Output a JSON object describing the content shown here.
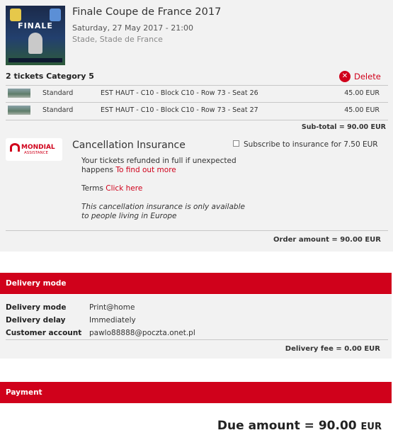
{
  "event": {
    "title": "Finale Coupe de France 2017",
    "date": "Saturday, 27 May 2017 - 21:00",
    "venue": "Stade, Stade de France",
    "thumbnail_word": "FINALE"
  },
  "tickets": {
    "header": "2 tickets Category 5",
    "delete_label": "Delete",
    "rows": [
      {
        "type": "Standard",
        "seat": "EST HAUT - C10 - Block C10 - Row 73 - Seat 26",
        "price": "45.00 EUR"
      },
      {
        "type": "Standard",
        "seat": "EST HAUT - C10 - Block C10 - Row 73 - Seat 27",
        "price": "45.00 EUR"
      }
    ],
    "subtotal": "Sub-total = 90.00 EUR"
  },
  "insurance": {
    "logo_brand": "MONDIAL",
    "logo_sub": "ASSISTANCE",
    "title": "Cancellation Insurance",
    "subscribe_label": "Subscribe to insurance for 7.50 EUR",
    "subscribe_checked": false,
    "refund_line1": "Your tickets refunded in full if unexpected",
    "refund_line2_text": "happens ",
    "refund_link": "To find out more",
    "terms_text": "Terms ",
    "terms_link": "Click here",
    "note_line1": "This cancellation insurance is only available",
    "note_line2": "to people living in Europe"
  },
  "order_amount": "Order amount = 90.00 EUR",
  "delivery": {
    "section_title": "Delivery mode",
    "rows": [
      {
        "label": "Delivery mode",
        "value": "Print@home"
      },
      {
        "label": "Delivery delay",
        "value": "Immediately"
      },
      {
        "label": "Customer account",
        "value": "pawlo88888@poczta.onet.pl"
      }
    ],
    "fee": "Delivery fee = 0.00 EUR"
  },
  "payment": {
    "section_title": "Payment",
    "due_label": "Due amount = 90.00",
    "due_unit": "EUR"
  },
  "colors": {
    "accent": "#d0011b",
    "panel_bg": "#f2f2f2"
  }
}
